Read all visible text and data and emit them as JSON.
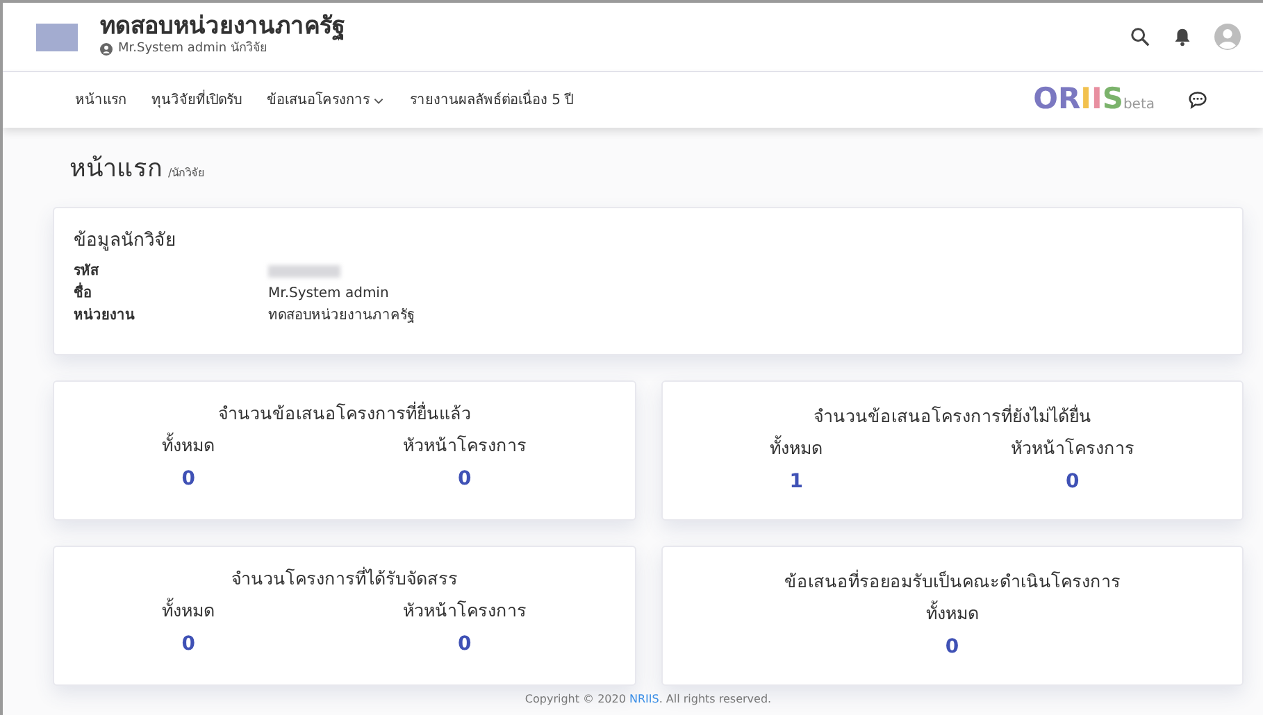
{
  "header": {
    "title": "ทดสอบหน่วยงานภาครัฐ",
    "user": "Mr.System admin นักวิจัย"
  },
  "nav": {
    "items": [
      {
        "label": "หน้าแรก",
        "dropdown": false
      },
      {
        "label": "ทุนวิจัยที่เปิดรับ",
        "dropdown": false
      },
      {
        "label": "ข้อเสนอโครงการ",
        "dropdown": true
      },
      {
        "label": "รายงานผลลัพธ์ต่อเนื่อง 5 ปี",
        "dropdown": false
      }
    ],
    "logo": {
      "letters": [
        {
          "text": "O",
          "color": "#7b78c1"
        },
        {
          "text": "R",
          "color": "#7b78c1"
        },
        {
          "text": "I",
          "color": "#f2c14e"
        },
        {
          "text": "I",
          "color": "#e88fa0"
        },
        {
          "text": "S",
          "color": "#7bb36b"
        }
      ],
      "suffix": "beta"
    }
  },
  "page": {
    "title": "หน้าแรก",
    "breadcrumb": "/นักวิจัย"
  },
  "researcher": {
    "title": "ข้อมูลนักวิจัย",
    "fields": [
      {
        "label": "รหัส",
        "blurred": true
      },
      {
        "label": "ชื่อ",
        "value": "Mr.System admin",
        "blurred": false
      },
      {
        "label": "หน่วยงาน",
        "value": "ทดสอบหน่วยงานภาครัฐ",
        "blurred": false
      }
    ]
  },
  "stats": [
    {
      "title": "จำนวนข้อเสนอโครงการที่ยื่นแล้ว",
      "columns": [
        {
          "label": "ทั้งหมด",
          "value": "0"
        },
        {
          "label": "หัวหน้าโครงการ",
          "value": "0"
        }
      ]
    },
    {
      "title": "จำนวนข้อเสนอโครงการที่ยังไม่ได้ยื่น",
      "columns": [
        {
          "label": "ทั้งหมด",
          "value": "1"
        },
        {
          "label": "หัวหน้าโครงการ",
          "value": "0"
        }
      ]
    },
    {
      "title": "จำนวนโครงการที่ได้รับจัดสรร",
      "columns": [
        {
          "label": "ทั้งหมด",
          "value": "0"
        },
        {
          "label": "หัวหน้าโครงการ",
          "value": "0"
        }
      ]
    },
    {
      "title": "ข้อเสนอที่รอยอมรับเป็นคณะดำเนินโครงการ",
      "columns": [
        {
          "label": "ทั้งหมด",
          "value": "0"
        }
      ]
    }
  ],
  "footer": {
    "before": "Copyright © 2020 ",
    "link": "NRIIS",
    "after": ". All rights reserved."
  }
}
